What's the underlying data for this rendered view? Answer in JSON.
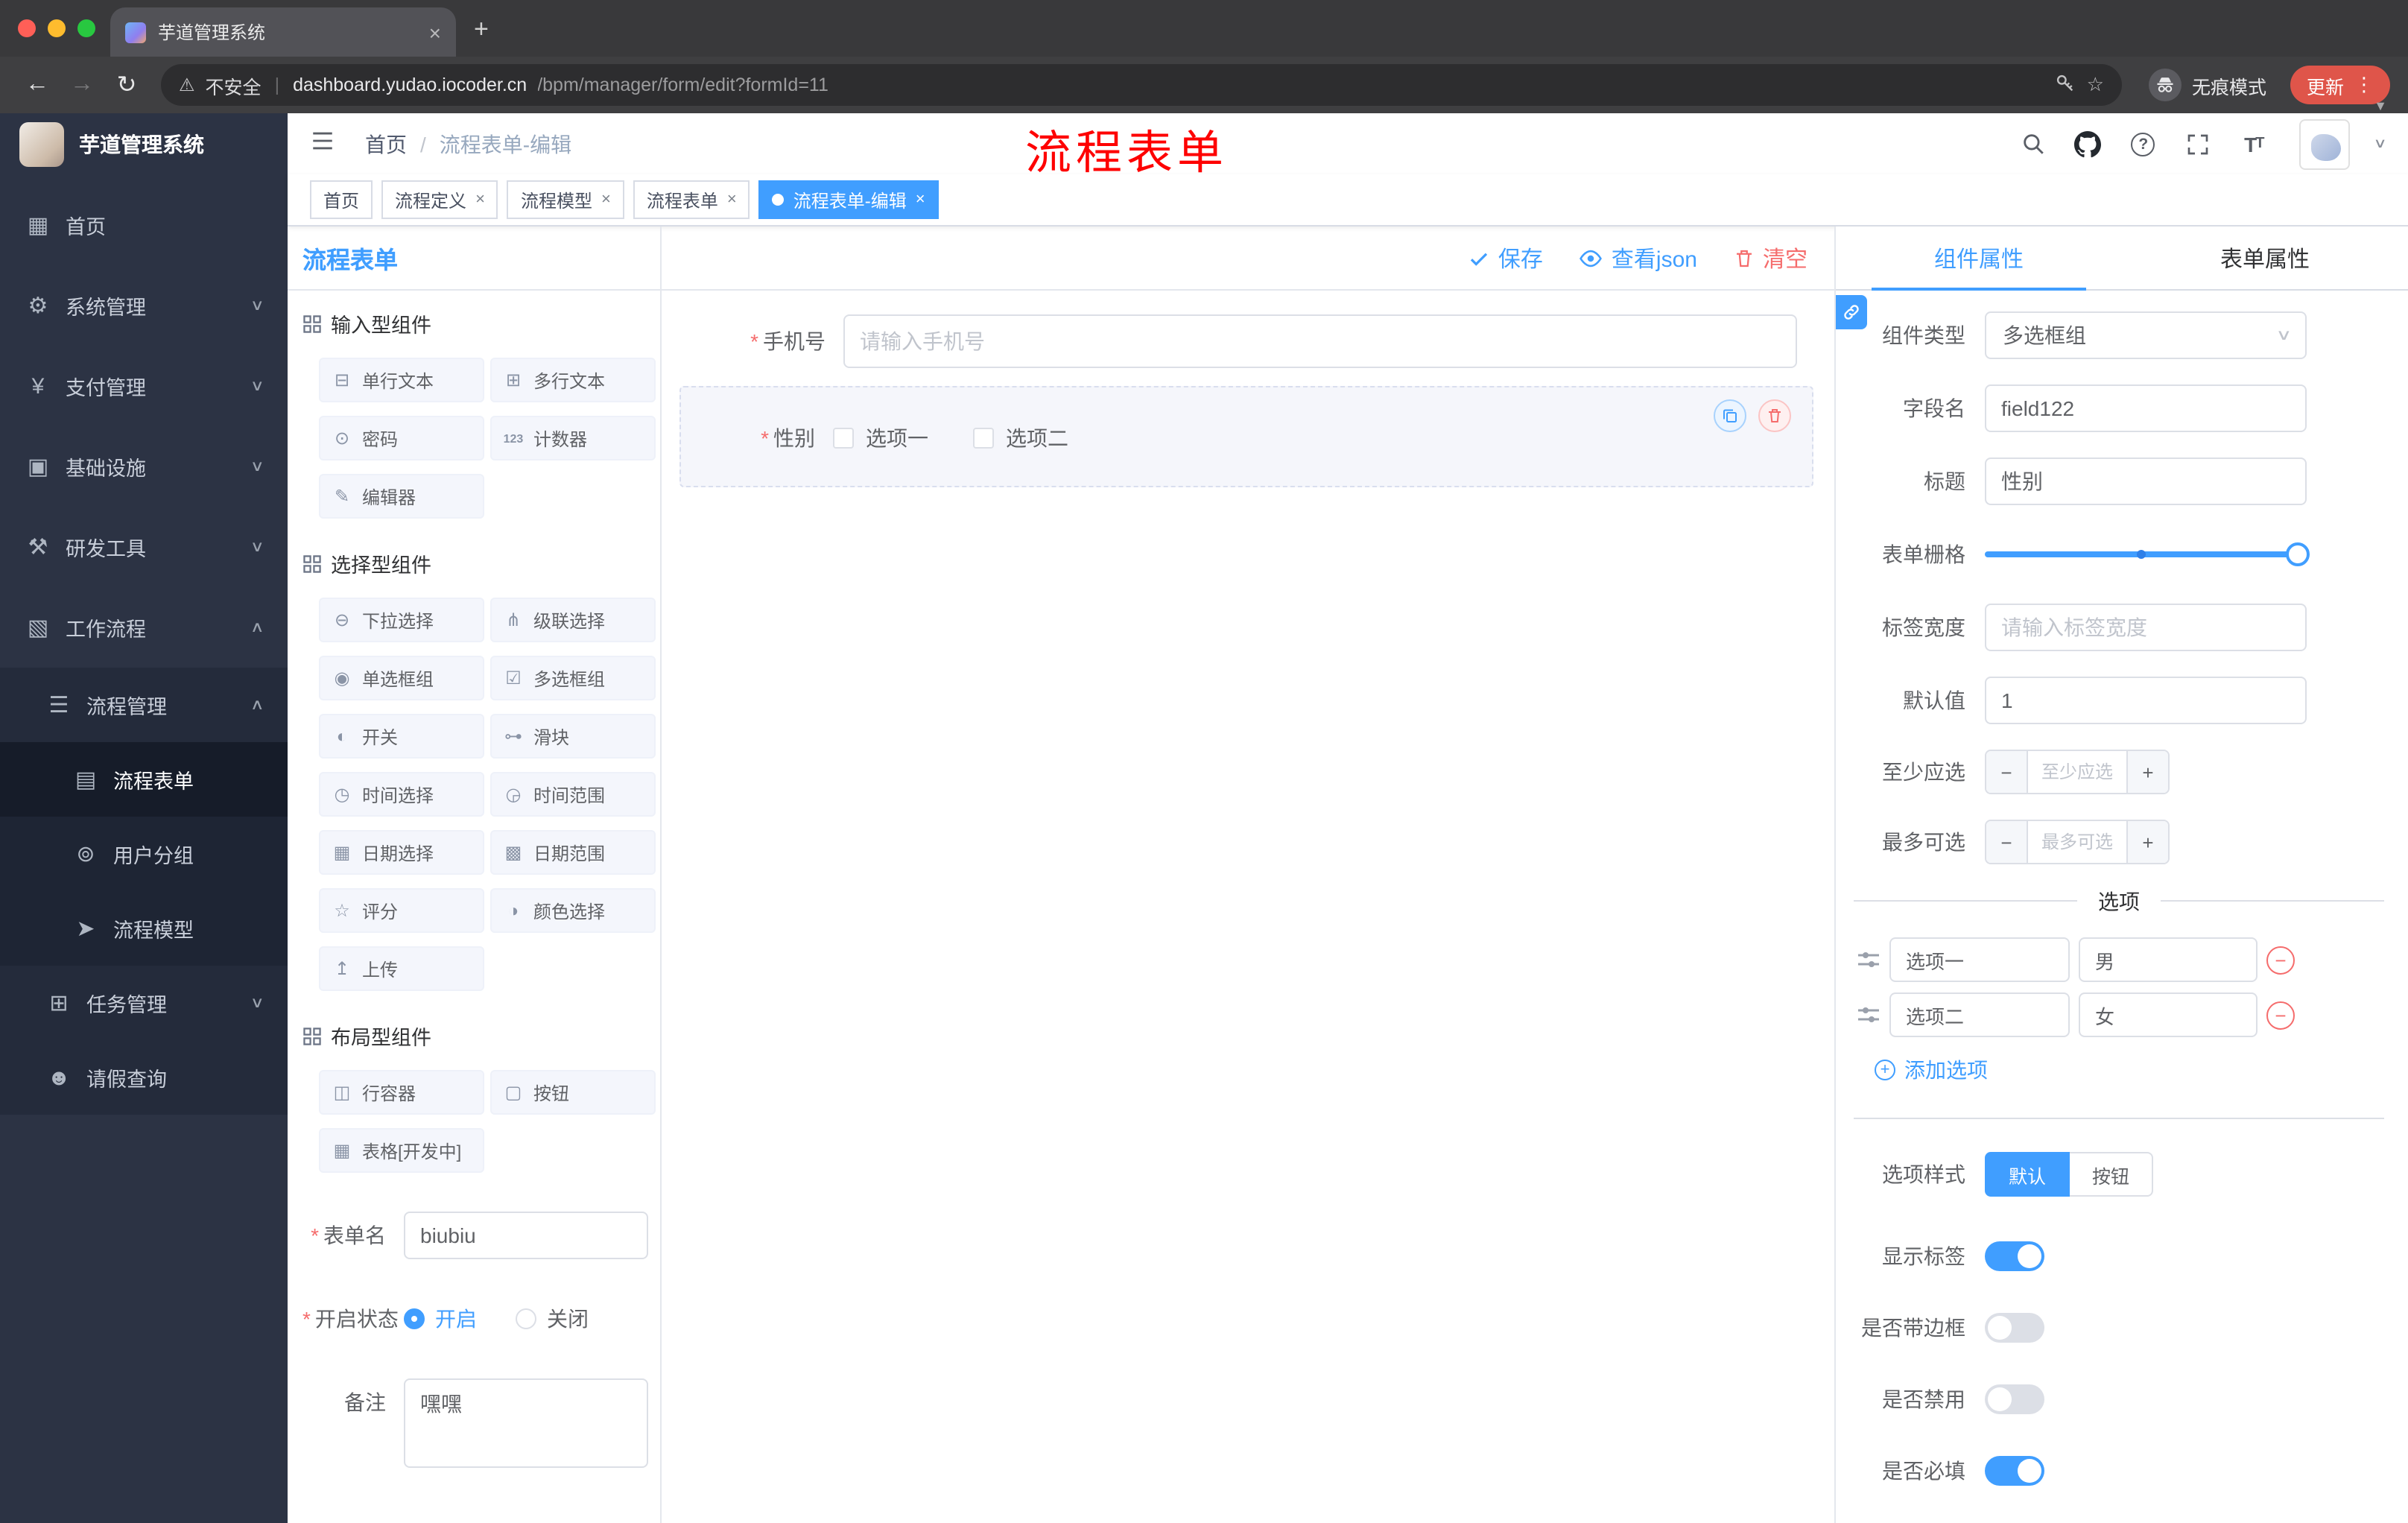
{
  "colors": {
    "accent": "#409eff",
    "danger": "#f56c6c",
    "annotation_red": "#fe0000",
    "sidebar_bg": "#2c3344",
    "active_tag": "#409eff"
  },
  "browser": {
    "tab_title": "芋道管理系统",
    "security_label": "不安全",
    "url_domain": "dashboard.yudao.iocoder.cn",
    "url_path": "/bpm/manager/form/edit?formId=11",
    "incognito_label": "无痕模式",
    "update_label": "更新"
  },
  "sidebar": {
    "logo_title": "芋道管理系统",
    "items": [
      {
        "label": "首页"
      },
      {
        "label": "系统管理"
      },
      {
        "label": "支付管理"
      },
      {
        "label": "基础设施"
      },
      {
        "label": "研发工具"
      },
      {
        "label": "工作流程"
      },
      {
        "label": "流程管理"
      },
      {
        "label": "流程表单"
      },
      {
        "label": "用户分组"
      },
      {
        "label": "流程模型"
      },
      {
        "label": "任务管理"
      },
      {
        "label": "请假查询"
      }
    ]
  },
  "header": {
    "breadcrumb_home": "首页",
    "breadcrumb_separator": "/",
    "breadcrumb_current": "流程表单-编辑",
    "annotation": "流程表单"
  },
  "tags": [
    {
      "label": "首页"
    },
    {
      "label": "流程定义"
    },
    {
      "label": "流程模型"
    },
    {
      "label": "流程表单"
    },
    {
      "label": "流程表单-编辑"
    }
  ],
  "palette": {
    "title": "流程表单",
    "group_input": "输入型组件",
    "group_select": "选择型组件",
    "group_layout": "布局型组件",
    "input_items": [
      "单行文本",
      "多行文本",
      "密码",
      "计数器",
      "编辑器"
    ],
    "select_items": [
      "下拉选择",
      "级联选择",
      "单选框组",
      "多选框组",
      "开关",
      "滑块",
      "时间选择",
      "时间范围",
      "日期选择",
      "日期范围",
      "评分",
      "颜色选择",
      "上传"
    ],
    "layout_items": [
      "行容器",
      "按钮",
      "表格[开发中]"
    ],
    "counter_icon_text": "123",
    "form_name_label": "表单名",
    "form_name_value": "biubiu",
    "status_label": "开启状态",
    "status_on": "开启",
    "status_off": "关闭",
    "remark_label": "备注",
    "remark_value": "嘿嘿"
  },
  "toolbar": {
    "save_label": "保存",
    "view_json_label": "查看json",
    "clear_label": "清空"
  },
  "canvas": {
    "phone_label": "手机号",
    "phone_placeholder": "请输入手机号",
    "gender_label": "性别",
    "gender_options": [
      "选项一",
      "选项二"
    ]
  },
  "props": {
    "tab_component": "组件属性",
    "tab_form": "表单属性",
    "type_label": "组件类型",
    "type_value": "多选框组",
    "field_label": "字段名",
    "field_value": "field122",
    "title_label": "标题",
    "title_value": "性别",
    "grid_label": "表单栅格",
    "label_width_label": "标签宽度",
    "label_width_placeholder": "请输入标签宽度",
    "default_label": "默认值",
    "default_value": "1",
    "min_label": "至少应选",
    "min_placeholder": "至少应选",
    "max_label": "最多可选",
    "max_placeholder": "最多可选",
    "options_divider": "选项",
    "options": [
      {
        "label": "选项一",
        "value": "男"
      },
      {
        "label": "选项二",
        "value": "女"
      }
    ],
    "add_option_label": "添加选项",
    "style_label": "选项样式",
    "style_default": "默认",
    "style_button": "按钮",
    "switch_show_label": "显示标签",
    "switch_border": "是否带边框",
    "switch_disabled": "是否禁用",
    "switch_required": "是否必填"
  }
}
